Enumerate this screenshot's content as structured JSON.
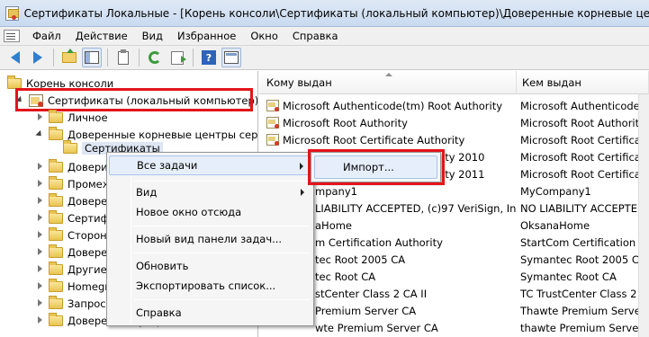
{
  "window": {
    "title": "Сертификаты Локальные - [Корень консоли\\Сертификаты (локальный компьютер)\\Доверенные корневые центры серти"
  },
  "menu": {
    "items": [
      "Файл",
      "Действие",
      "Вид",
      "Избранное",
      "Окно",
      "Справка"
    ]
  },
  "toolbar": {
    "buttons": [
      "back-icon",
      "forward-icon",
      "up-folder-icon",
      "show-hide-tree-icon",
      "properties-icon",
      "refresh-icon",
      "export-list-icon",
      "help-icon",
      "view-pane-icon"
    ]
  },
  "tree": {
    "root": "Корень консоли",
    "computer": "Сертификаты (локальный компьютер)",
    "items": [
      "Личное",
      "Доверенные корневые центры серт",
      "Сертификаты",
      "Довери",
      "Промеж",
      "Довере",
      "Сертиф",
      "Сторон",
      "Довере",
      "Другие",
      "Homegr",
      "Запрос",
      "Доверенные устройства"
    ]
  },
  "list": {
    "columns": [
      "Кому выдан",
      "Кем выдан"
    ],
    "rows": [
      {
        "issued_to": "Microsoft Authenticode(tm) Root Authority",
        "issued_by": "Microsoft Authenticode"
      },
      {
        "issued_to": "Microsoft Root Authority",
        "issued_by": "Microsoft Root Authority"
      },
      {
        "issued_to": "Microsoft Root Certificate Authority",
        "issued_by": "Microsoft Root Certificate"
      },
      {
        "issued_to": "ity 2010",
        "issued_by": "Microsoft Root Certificate"
      },
      {
        "issued_to": "ity 2011",
        "issued_by": "Microsoft Root Certificate"
      },
      {
        "issued_to": "mpany1",
        "issued_by": "MyCompany1"
      },
      {
        "issued_to": "LIABILITY ACCEPTED, (c)97 VeriSign, Inc.",
        "issued_by": "NO LIABILITY ACCEPTED, ("
      },
      {
        "issued_to": "aHome",
        "issued_by": "OksanaHome"
      },
      {
        "issued_to": "m Certification Authority",
        "issued_by": "StartCom Certification Au"
      },
      {
        "issued_to": "tec Root 2005 CA",
        "issued_by": "Symantec Root 2005 CA"
      },
      {
        "issued_to": "tec Root CA",
        "issued_by": "Symantec Root CA"
      },
      {
        "issued_to": "stCenter Class 2 CA II",
        "issued_by": "TC TrustCenter Class 2 CA"
      },
      {
        "issued_to": "Premium Server CA",
        "issued_by": "Thawte Premium Server CA"
      },
      {
        "issued_to": "wte Premium Server CA",
        "issued_by": "thawte Premium Server CA"
      }
    ]
  },
  "context_menu": {
    "all_tasks": "Все задачи",
    "view": "Вид",
    "new_window": "Новое окно отсюда",
    "new_taskpad": "Новый вид панели задач...",
    "refresh": "Обновить",
    "export_list": "Экспортировать список...",
    "help": "Справка"
  },
  "submenu": {
    "import": "Импорт..."
  },
  "colors": {
    "highlight_box": "#e3141b",
    "menu_hover": "#e6eefb"
  }
}
